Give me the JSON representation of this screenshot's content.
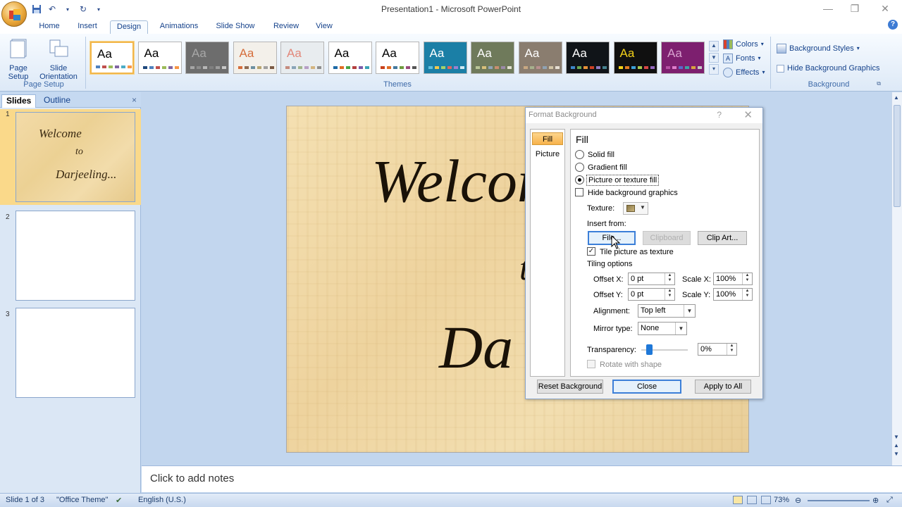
{
  "window": {
    "title": "Presentation1 - Microsoft PowerPoint",
    "minimize": "—",
    "restore": "❐",
    "close": "✕"
  },
  "qat": [
    "save-icon",
    "undo-icon",
    "dropdown-icon",
    "redo-icon",
    "customize-icon"
  ],
  "ribbon": {
    "tabs": [
      "Home",
      "Insert",
      "Design",
      "Animations",
      "Slide Show",
      "Review",
      "View"
    ],
    "active_tab": "Design",
    "page_setup": {
      "page_setup_label": "Page Setup",
      "slide_orientation_label": "Slide Orientation",
      "group_label": "Page Setup"
    },
    "themes": {
      "group_label": "Themes",
      "sample": "Aa",
      "items": [
        {
          "bg": "#ffffff",
          "fg": "#000000",
          "dots": [
            "#4f81bd",
            "#c0504d",
            "#9bbb59",
            "#8064a2",
            "#4bacc6",
            "#f79646"
          ]
        },
        {
          "bg": "#ffffff",
          "fg": "#000000",
          "dots": [
            "#1f497d",
            "#4f81bd",
            "#c0504d",
            "#9bbb59",
            "#8064a2",
            "#f79646"
          ]
        },
        {
          "bg": "#6d6d6d",
          "fg": "#a7a7a7",
          "dots": [
            "#a5a5a5",
            "#8c8c8c",
            "#b7b7b7",
            "#7f7f7f",
            "#9d9d9d",
            "#c8c8c8"
          ]
        },
        {
          "bg": "#f3f0ea",
          "fg": "#d56d3b",
          "dots": [
            "#d56d3b",
            "#8e6b52",
            "#6b8f9f",
            "#b7a470",
            "#a0a0a0",
            "#7b5a44"
          ]
        },
        {
          "bg": "#e8ecef",
          "fg": "#e2877a",
          "dots": [
            "#c58b7e",
            "#89a4b8",
            "#a1b58b",
            "#b79fc6",
            "#d3b480",
            "#8e8e8e"
          ]
        },
        {
          "bg": "#ffffff",
          "fg": "#000000",
          "dots": [
            "#1d6aa6",
            "#e06d24",
            "#46a546",
            "#b33f3f",
            "#7a5aa8",
            "#3aa3b5"
          ]
        },
        {
          "bg": "#ffffff",
          "fg": "#000000",
          "dots": [
            "#c9411b",
            "#e06d24",
            "#44799e",
            "#6f9a3f",
            "#9a4a7c",
            "#555555"
          ]
        },
        {
          "bg": "#1b7fa6",
          "fg": "#ffffff",
          "dots": [
            "#5ec0e0",
            "#f2c94c",
            "#a3d16b",
            "#e0665e",
            "#9b7fd1",
            "#cfe9f2"
          ]
        },
        {
          "bg": "#6f7a5b",
          "fg": "#ffffff",
          "dots": [
            "#b9c597",
            "#d9c07a",
            "#8fa5b8",
            "#c98e6f",
            "#9c8aa8",
            "#e2e2d0"
          ]
        },
        {
          "bg": "#8a7d6f",
          "fg": "#ffffff",
          "dots": [
            "#c8a882",
            "#a6b08c",
            "#b98f8f",
            "#8fa2b3",
            "#d2c5a5",
            "#e7e0d4"
          ]
        },
        {
          "bg": "#101418",
          "fg": "#ffffff",
          "dots": [
            "#3d85c6",
            "#6aa84f",
            "#e69138",
            "#cc4125",
            "#8e7cc3",
            "#45818e"
          ]
        },
        {
          "bg": "#101010",
          "fg": "#f4d21a",
          "dots": [
            "#f4d21a",
            "#e07b23",
            "#3d9fd6",
            "#a7c94c",
            "#d64646",
            "#9467bd"
          ]
        },
        {
          "bg": "#7d1f6f",
          "fg": "#d9a3d0",
          "dots": [
            "#b44fa3",
            "#e07ccb",
            "#5b6ac9",
            "#3fa3a3",
            "#d9a33f",
            "#c7c7c7"
          ]
        }
      ]
    },
    "theme_options": {
      "colors": "Colors",
      "fonts": "Fonts",
      "effects": "Effects"
    },
    "background": {
      "styles_label": "Background Styles",
      "hide_graphics_label": "Hide Background Graphics",
      "group_label": "Background"
    }
  },
  "slides_pane": {
    "tabs": [
      "Slides",
      "Outline"
    ],
    "active_tab": "Slides",
    "close": "×",
    "slides": [
      {
        "number": "1",
        "lines": [
          "Welcome",
          "to",
          "Darjeeling..."
        ]
      },
      {
        "number": "2",
        "lines": []
      },
      {
        "number": "3",
        "lines": []
      }
    ]
  },
  "slide": {
    "line1": "Welcom",
    "line2": "t",
    "line3": "Da"
  },
  "notes": {
    "placeholder": "Click to add notes"
  },
  "statusbar": {
    "slide_info": "Slide 1 of 3",
    "theme": "\"Office Theme\"",
    "language": "English (U.S.)",
    "zoom": "73%"
  },
  "dialog": {
    "title": "Format Background",
    "help": "?",
    "close": "✕",
    "nav": [
      "Fill",
      "Picture"
    ],
    "active_nav": "Fill",
    "heading": "Fill",
    "options": {
      "solid_fill": "Solid fill",
      "gradient_fill": "Gradient fill",
      "picture_fill": "Picture or texture fill",
      "hide_graphics": "Hide background graphics"
    },
    "selected_option": "Picture or texture fill",
    "hide_graphics_checked": false,
    "texture_label": "Texture:",
    "insert_from_label": "Insert from:",
    "buttons": {
      "file": "File...",
      "clipboard": "Clipboard",
      "clip_art": "Clip Art...",
      "reset": "Reset Background",
      "close": "Close",
      "apply_all": "Apply to All"
    },
    "tile_label": "Tile picture as texture",
    "tile_checked": true,
    "tiling_options_label": "Tiling options",
    "offset_x_label": "Offset X:",
    "offset_x": "0 pt",
    "offset_y_label": "Offset Y:",
    "offset_y": "0 pt",
    "scale_x_label": "Scale X:",
    "scale_x": "100%",
    "scale_y_label": "Scale Y:",
    "scale_y": "100%",
    "alignment_label": "Alignment:",
    "alignment": "Top left",
    "mirror_label": "Mirror type:",
    "mirror": "None",
    "transparency_label": "Transparency:",
    "transparency": "0%",
    "transparency_value": 0,
    "rotate_label": "Rotate with shape",
    "rotate_checked": false
  }
}
